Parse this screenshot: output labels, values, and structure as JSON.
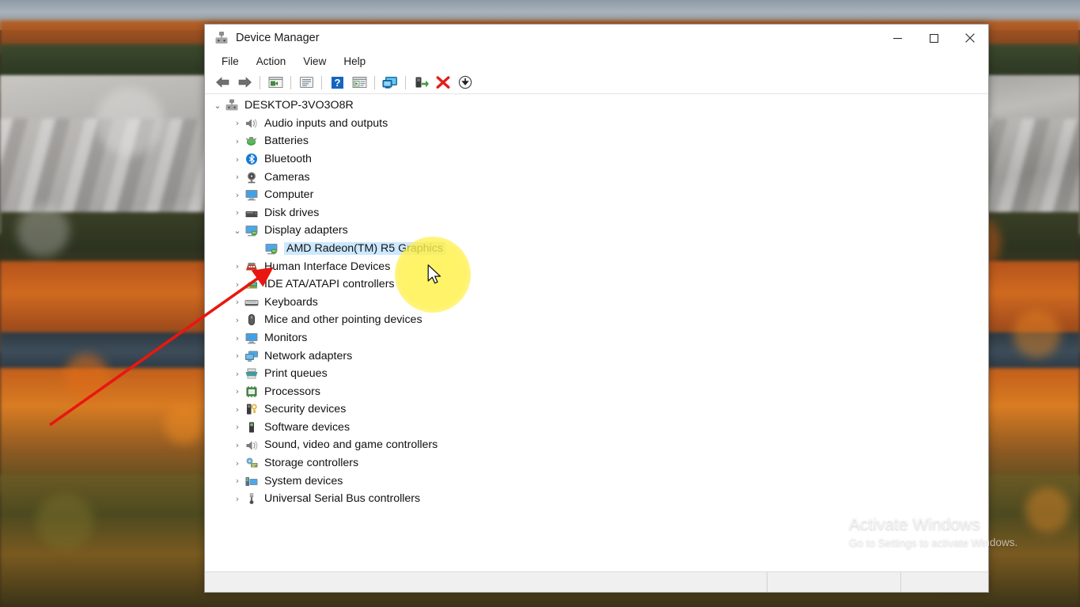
{
  "window": {
    "title": "Device Manager",
    "icon": "device-manager-icon",
    "controls": {
      "minimize": "–",
      "maximize": "□",
      "close": "✕"
    }
  },
  "menubar": {
    "items": [
      {
        "label": "File",
        "name": "menu-file"
      },
      {
        "label": "Action",
        "name": "menu-action"
      },
      {
        "label": "View",
        "name": "menu-view"
      },
      {
        "label": "Help",
        "name": "menu-help"
      }
    ]
  },
  "toolbar": {
    "buttons": [
      {
        "name": "back-icon",
        "tooltip": "Back"
      },
      {
        "name": "forward-icon",
        "tooltip": "Forward"
      },
      {
        "name": "show-hide-console-tree-icon",
        "tooltip": "Show/Hide Console Tree"
      },
      {
        "name": "properties-icon",
        "tooltip": "Properties"
      },
      {
        "name": "help-icon",
        "tooltip": "Help"
      },
      {
        "name": "update-driver-icon",
        "tooltip": "Update driver"
      },
      {
        "name": "scan-for-hardware-changes-icon",
        "tooltip": "Scan for hardware changes"
      },
      {
        "name": "enable-device-icon",
        "tooltip": "Enable device"
      },
      {
        "name": "uninstall-device-icon",
        "tooltip": "Uninstall device"
      },
      {
        "name": "install-legacy-hardware-icon",
        "tooltip": "Add legacy hardware"
      }
    ]
  },
  "tree": {
    "root": {
      "label": "DESKTOP-3VO3O8R",
      "icon": "computer-root-icon",
      "expanded": true,
      "chevron": "⌄"
    },
    "chevron_collapsed": "›",
    "chevron_expanded": "⌄",
    "items": [
      {
        "label": "Audio inputs and outputs",
        "icon": "speaker-icon",
        "expanded": false,
        "indent": 1
      },
      {
        "label": "Batteries",
        "icon": "battery-icon",
        "expanded": false,
        "indent": 1
      },
      {
        "label": "Bluetooth",
        "icon": "bluetooth-icon",
        "expanded": false,
        "indent": 1
      },
      {
        "label": "Cameras",
        "icon": "camera-icon",
        "expanded": false,
        "indent": 1
      },
      {
        "label": "Computer",
        "icon": "computer-icon",
        "expanded": false,
        "indent": 1
      },
      {
        "label": "Disk drives",
        "icon": "disk-drive-icon",
        "expanded": false,
        "indent": 1
      },
      {
        "label": "Display adapters",
        "icon": "display-adapter-icon",
        "expanded": true,
        "indent": 1
      },
      {
        "label": "AMD Radeon(TM) R5 Graphics",
        "icon": "graphics-card-icon",
        "expanded": null,
        "indent": 2,
        "selected": true
      },
      {
        "label": "Human Interface Devices",
        "icon": "hid-icon",
        "expanded": false,
        "indent": 1
      },
      {
        "label": "IDE ATA/ATAPI controllers",
        "icon": "ide-controller-icon",
        "expanded": false,
        "indent": 1
      },
      {
        "label": "Keyboards",
        "icon": "keyboard-icon",
        "expanded": false,
        "indent": 1
      },
      {
        "label": "Mice and other pointing devices",
        "icon": "mouse-icon",
        "expanded": false,
        "indent": 1
      },
      {
        "label": "Monitors",
        "icon": "monitor-icon",
        "expanded": false,
        "indent": 1
      },
      {
        "label": "Network adapters",
        "icon": "network-adapter-icon",
        "expanded": false,
        "indent": 1
      },
      {
        "label": "Print queues",
        "icon": "printer-icon",
        "expanded": false,
        "indent": 1
      },
      {
        "label": "Processors",
        "icon": "processor-icon",
        "expanded": false,
        "indent": 1
      },
      {
        "label": "Security devices",
        "icon": "security-device-icon",
        "expanded": false,
        "indent": 1
      },
      {
        "label": "Software devices",
        "icon": "software-device-icon",
        "expanded": false,
        "indent": 1
      },
      {
        "label": "Sound, video and game controllers",
        "icon": "sound-controller-icon",
        "expanded": false,
        "indent": 1
      },
      {
        "label": "Storage controllers",
        "icon": "storage-controller-icon",
        "expanded": false,
        "indent": 1
      },
      {
        "label": "System devices",
        "icon": "system-device-icon",
        "expanded": false,
        "indent": 1
      },
      {
        "label": "Universal Serial Bus controllers",
        "icon": "usb-controller-icon",
        "expanded": false,
        "indent": 1
      }
    ]
  },
  "statusbar": {
    "main": "",
    "cell_b": "",
    "cell_c": ""
  },
  "annotations": {
    "spotlight": {
      "name": "highlight-spotlight",
      "color": "#fff24a"
    },
    "arrow": {
      "name": "pointer-arrow-annotation",
      "color": "#e8170f"
    },
    "cursor": {
      "name": "mouse-cursor"
    }
  },
  "watermark": {
    "title": "Activate Windows",
    "subtitle": "Go to Settings to activate Windows."
  },
  "colors": {
    "selection": "#cce8ff",
    "window_bg": "#ffffff",
    "statusbar_bg": "#f0f0f0",
    "annotation_red": "#e8170f",
    "spotlight_yellow": "#fff24a"
  }
}
